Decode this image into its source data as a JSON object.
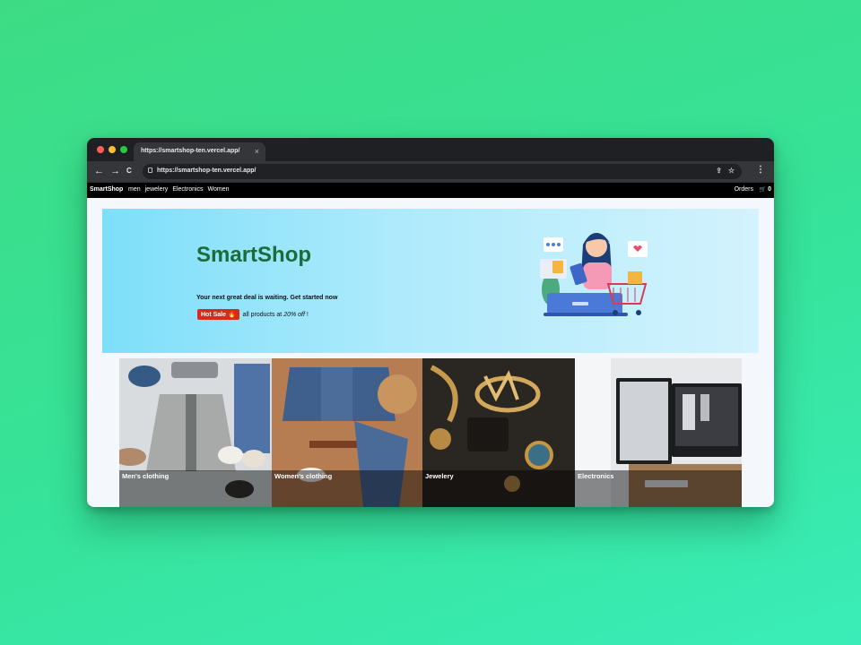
{
  "browser": {
    "tab_title": "https://smartshop-ten.vercel.app/",
    "tab_close": "×",
    "url": "https://smartshop-ten.vercel.app/",
    "back": "←",
    "forward": "→",
    "reload": "C",
    "share": "⇪",
    "bookmark": "☆",
    "menu": "⋮"
  },
  "nav": {
    "brand": "SmartShop",
    "links": [
      "men",
      "jewelery",
      "Electronics",
      "Women"
    ],
    "orders": "Orders",
    "cart_icon": "🛒",
    "cart_count": "0"
  },
  "hero": {
    "title": "SmartShop",
    "subtitle": "Your next great deal is waiting. Get started now",
    "badge": "Hot Sale 🔥",
    "sale_prefix": "all products at ",
    "sale_discount": "20% off",
    "sale_suffix": " !"
  },
  "categories": [
    {
      "label": "Men's clothing"
    },
    {
      "label": "Women's clothing"
    },
    {
      "label": "Jewelery"
    },
    {
      "label": "Electronics"
    }
  ],
  "colors": {
    "hero_title": "#1c6b3a",
    "badge": "#d42b1f",
    "nav_bg": "#000000"
  }
}
